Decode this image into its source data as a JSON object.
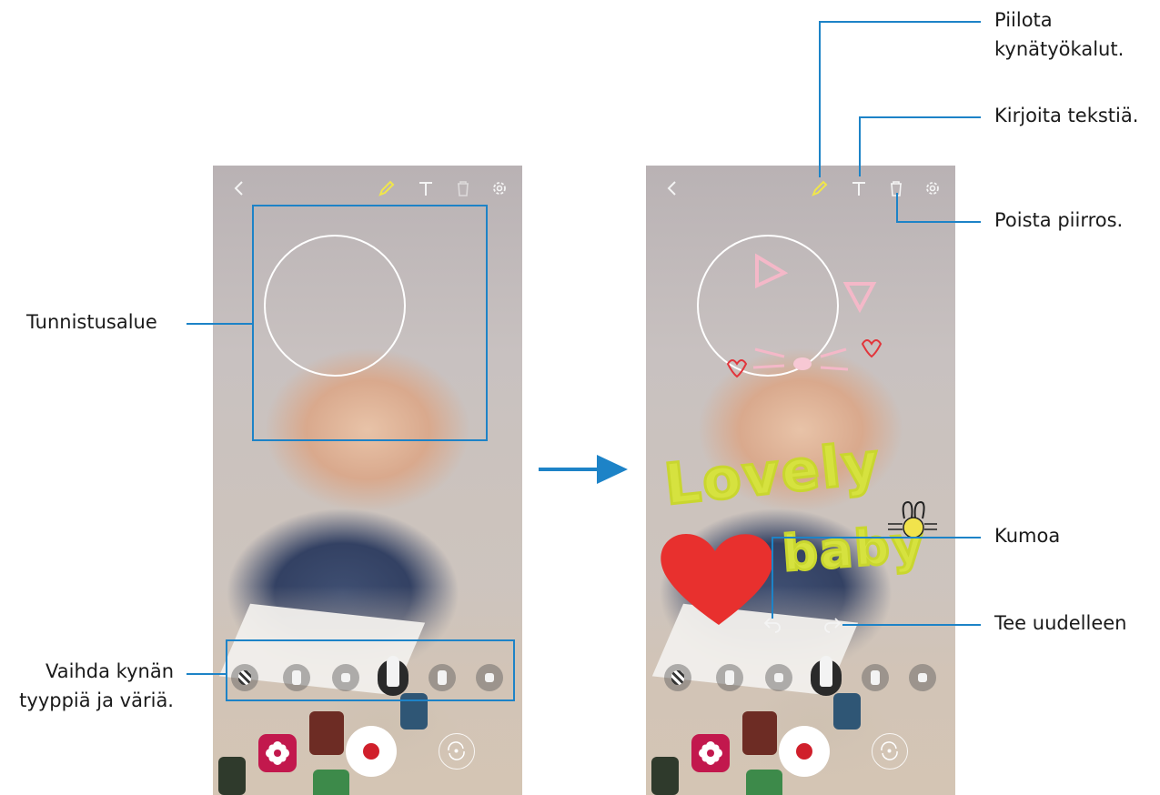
{
  "left_phone": {
    "toolbar": {
      "back": "back-icon",
      "pen": "pen-icon",
      "text": "text-icon",
      "delete": "trash-icon",
      "settings": "gear-icon"
    },
    "pen_tools_count": 6,
    "buttons": [
      "effects",
      "record",
      "switch-camera"
    ]
  },
  "right_phone": {
    "drawing": {
      "word1": "Lovely",
      "word2": "baby"
    }
  },
  "callouts": {
    "recognition_area": "Tunnistusalue",
    "change_pen_line1": "Vaihda kynän",
    "change_pen_line2": "tyyppiä ja väriä.",
    "hide_pen_line1": "Piilota",
    "hide_pen_line2": "kynätyökalut.",
    "write_text": "Kirjoita tekstiä.",
    "delete_drawing": "Poista piirros.",
    "undo": "Kumoa",
    "redo": "Tee uudelleen"
  },
  "colors": {
    "callout_line": "#1d83c7",
    "arrow": "#1d83c7",
    "record_dot": "#d01f2b",
    "effects_button": "#c2184d",
    "pen_active": "#f0e64a"
  }
}
